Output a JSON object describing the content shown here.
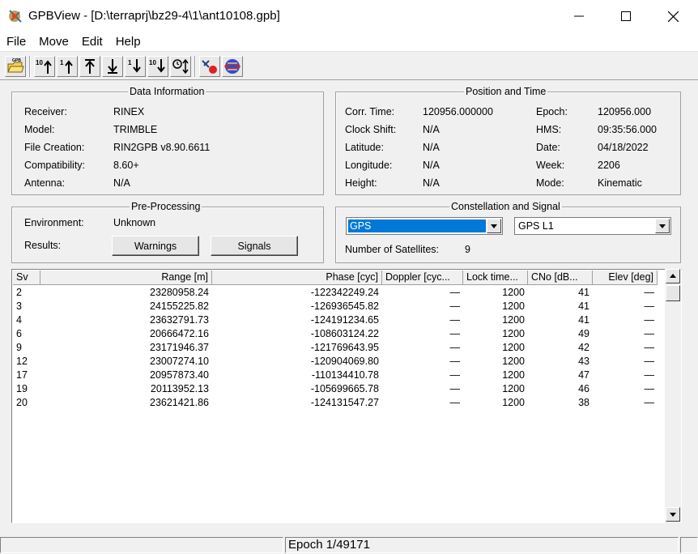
{
  "window": {
    "title": "GPBView - [D:\\terraprj\\bz29-4\\1\\ant10108.gpb]",
    "minimize": "—",
    "maximize": "☐",
    "close": "✕"
  },
  "menu": [
    "File",
    "Move",
    "Edit",
    "Help"
  ],
  "toolbar": {
    "buttons": [
      {
        "name": "open-gpb-icon",
        "label": "GPB"
      },
      {
        "name": "first-10-icon",
        "label": "10⇑"
      },
      {
        "name": "first-1-icon",
        "label": "1⇑"
      },
      {
        "name": "go-first-icon",
        "label": "⤒"
      },
      {
        "name": "go-last-icon",
        "label": "⤓"
      },
      {
        "name": "next-1-icon",
        "label": "1⇓"
      },
      {
        "name": "next-10-icon",
        "label": "10⇓"
      },
      {
        "name": "goto-epoch-icon",
        "label": "⏱"
      },
      {
        "name": "satellite-stop-icon",
        "label": "✈"
      },
      {
        "name": "globe-icon",
        "label": "🌐"
      }
    ]
  },
  "data_information": {
    "title": "Data Information",
    "receiver_label": "Receiver:",
    "receiver": "RINEX",
    "model_label": "Model:",
    "model": "TRIMBLE",
    "file_creation_label": "File Creation:",
    "file_creation": "RIN2GPB v8.90.6611",
    "compatibility_label": "Compatibility:",
    "compatibility": "8.60+",
    "antenna_label": "Antenna:",
    "antenna": "N/A"
  },
  "position_time": {
    "title": "Position and Time",
    "corr_time_label": "Corr. Time:",
    "corr_time": "120956.000000",
    "clock_shift_label": "Clock Shift:",
    "clock_shift": "N/A",
    "latitude_label": "Latitude:",
    "latitude": "N/A",
    "longitude_label": "Longitude:",
    "longitude": "N/A",
    "height_label": "Height:",
    "height": "N/A",
    "epoch_label": "Epoch:",
    "epoch": "120956.000",
    "hms_label": "HMS:",
    "hms": "09:35:56.000",
    "date_label": "Date:",
    "date": "04/18/2022",
    "week_label": "Week:",
    "week": "2206",
    "mode_label": "Mode:",
    "mode": "Kinematic"
  },
  "preprocessing": {
    "title": "Pre-Processing",
    "environment_label": "Environment:",
    "environment": "Unknown",
    "results_label": "Results:",
    "warnings_button": "Warnings",
    "signals_button": "Signals"
  },
  "constellation": {
    "title": "Constellation and Signal",
    "constellation_value": "GPS",
    "signal_value": "GPS L1",
    "num_sats_label": "Number of Satellites:",
    "num_sats": "9"
  },
  "table": {
    "headers": [
      "Sv",
      "Range [m]",
      "Phase [cyc]",
      "Doppler [cyc...",
      "Lock time...",
      "CNo [dB...",
      "Elev [deg]"
    ],
    "rows": [
      [
        "2",
        "23280958.24",
        "-122342249.24",
        "—",
        "1200",
        "41",
        "—"
      ],
      [
        "3",
        "24155225.82",
        "-126936545.82",
        "—",
        "1200",
        "41",
        "—"
      ],
      [
        "4",
        "23632791.73",
        "-124191234.65",
        "—",
        "1200",
        "41",
        "—"
      ],
      [
        "6",
        "20666472.16",
        "-108603124.22",
        "—",
        "1200",
        "49",
        "—"
      ],
      [
        "9",
        "23171946.37",
        "-121769643.95",
        "—",
        "1200",
        "42",
        "—"
      ],
      [
        "12",
        "23007274.10",
        "-120904069.80",
        "—",
        "1200",
        "43",
        "—"
      ],
      [
        "17",
        "20957873.40",
        "-110134410.78",
        "—",
        "1200",
        "47",
        "—"
      ],
      [
        "19",
        "20113952.13",
        "-105699665.78",
        "—",
        "1200",
        "46",
        "—"
      ],
      [
        "20",
        "23621421.86",
        "-124131547.27",
        "—",
        "1200",
        "38",
        "—"
      ]
    ]
  },
  "status": {
    "epoch_text": "Epoch 1/49171"
  },
  "colors": {
    "selection": "#0078d7",
    "background": "#f0f0f0"
  }
}
